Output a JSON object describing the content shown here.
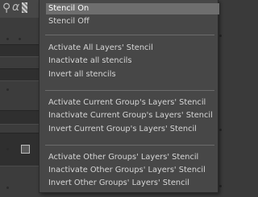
{
  "background": {
    "left_icons": [
      "search-icon",
      "alpha-icon",
      "checkerboard-icon"
    ],
    "alpha_symbol": "α"
  },
  "menu": {
    "items": [
      {
        "label": "Stencil On",
        "highlighted": true
      },
      {
        "label": "Stencil Off"
      },
      {
        "label": "Activate All Layers' Stencil"
      },
      {
        "label": "Inactivate all stencils"
      },
      {
        "label": "Invert all stencils"
      },
      {
        "label": "Activate Current Group's Layers' Stencil"
      },
      {
        "label": "Inactivate Current Group's Layers' Stencil"
      },
      {
        "label": "Invert Current Group's Layers' Stencil"
      },
      {
        "label": "Activate Other Groups' Layers' Stencil"
      },
      {
        "label": "Inactivate Other Groups' Layers' Stencil"
      },
      {
        "label": "Invert Other Groups' Layers' Stencil"
      }
    ]
  },
  "colors": {
    "menu_bg": "#474747",
    "highlight_bg": "#6e6e6e",
    "text": "#d6d6d6",
    "separator": "#6b6b6b"
  }
}
